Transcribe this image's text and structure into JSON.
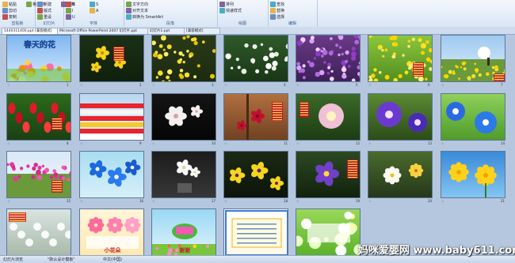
{
  "ribbon": {
    "groups": [
      {
        "label": "剪贴板",
        "buttons": [
          "粘贴",
          "剪切",
          "复制",
          "格式刷"
        ]
      },
      {
        "label": "幻灯片",
        "buttons": [
          "新建",
          "版式",
          "重设",
          "删除"
        ]
      },
      {
        "label": "字体",
        "buttons": [
          "B",
          "I",
          "U",
          "S",
          "A"
        ]
      },
      {
        "label": "段落",
        "buttons": [
          "文字方向",
          "对齐文本",
          "转换为 SmartArt"
        ]
      },
      {
        "label": "绘图",
        "buttons": [
          "排列",
          "快速样式"
        ]
      },
      {
        "label": "编辑",
        "buttons": [
          "查找",
          "替换",
          "选择"
        ]
      }
    ]
  },
  "tabs": [
    {
      "label": "1440311400.ppt [兼容模式]",
      "active": true
    },
    {
      "label": "Microsoft Office PowerPoint 2007 幻灯片.ppt",
      "active": false
    },
    {
      "label": "幻灯片1.ppt",
      "active": false
    },
    {
      "label": "[兼容模式]",
      "active": false
    }
  ],
  "slides": [
    {
      "num": "1",
      "title": "春天的花"
    },
    {
      "num": "2",
      "title": ""
    },
    {
      "num": "3",
      "title": ""
    },
    {
      "num": "4",
      "title": ""
    },
    {
      "num": "5",
      "title": ""
    },
    {
      "num": "6",
      "title": ""
    },
    {
      "num": "7",
      "title": ""
    },
    {
      "num": "8",
      "title": ""
    },
    {
      "num": "9",
      "title": ""
    },
    {
      "num": "10",
      "title": ""
    },
    {
      "num": "11",
      "title": ""
    },
    {
      "num": "12",
      "title": ""
    },
    {
      "num": "13",
      "title": ""
    },
    {
      "num": "14",
      "title": ""
    },
    {
      "num": "15",
      "title": ""
    },
    {
      "num": "16",
      "title": ""
    },
    {
      "num": "17",
      "title": ""
    },
    {
      "num": "18",
      "title": ""
    },
    {
      "num": "19",
      "title": ""
    },
    {
      "num": "20",
      "title": ""
    },
    {
      "num": "21",
      "title": ""
    },
    {
      "num": "22",
      "title": ""
    },
    {
      "num": "23",
      "title": "小花朵"
    },
    {
      "num": "24",
      "title": "谢谢"
    },
    {
      "num": "25",
      "title": ""
    },
    {
      "num": "26",
      "title": ""
    }
  ],
  "status": {
    "slide_sorter": "幻灯片浏览",
    "theme": "\"默认设计模板\"",
    "language": "中文(中国)"
  },
  "watermark": "妈咪爱婴网 www.baby611.com"
}
